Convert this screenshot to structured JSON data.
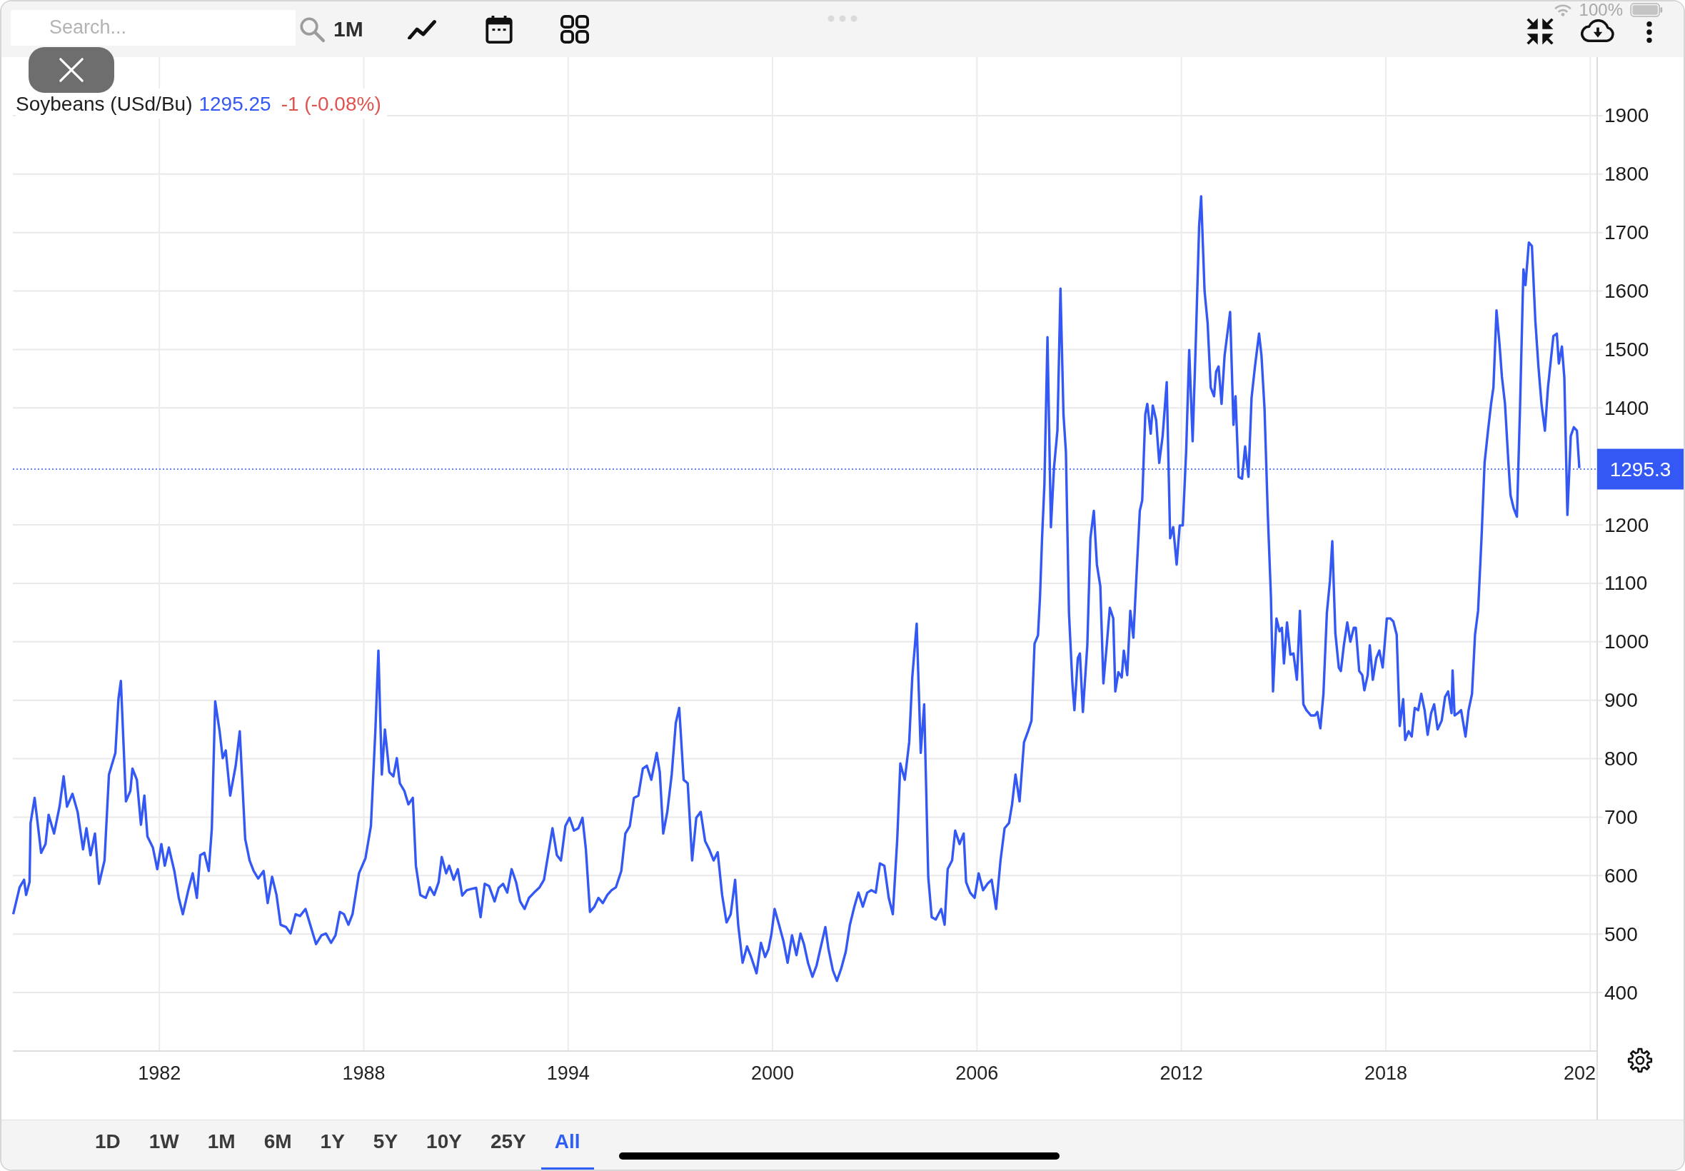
{
  "toolbar": {
    "search": {
      "placeholder": "Search..."
    },
    "interval": "1M"
  },
  "status_bar": {
    "battery": "100%"
  },
  "legend": {
    "price": "1295.25",
    "change": "-1 (-0.08%)"
  },
  "chart": {
    "chart_data": {
      "type": "line",
      "x": [
        1977.71,
        1977.9,
        1978.03,
        1978.09,
        1978.19,
        1978.22,
        1978.34,
        1978.53,
        1978.66,
        1978.75,
        1978.91,
        1979.07,
        1979.19,
        1979.29,
        1979.45,
        1979.6,
        1979.76,
        1979.86,
        1979.98,
        1980.11,
        1980.23,
        1980.39,
        1980.52,
        1980.71,
        1980.8,
        1980.87,
        1981.02,
        1981.15,
        1981.21,
        1981.34,
        1981.46,
        1981.56,
        1981.65,
        1981.81,
        1981.94,
        1982.06,
        1982.16,
        1982.28,
        1982.44,
        1982.57,
        1982.69,
        1982.85,
        1982.98,
        1983.1,
        1983.2,
        1983.32,
        1983.45,
        1983.54,
        1983.64,
        1983.77,
        1983.86,
        1983.95,
        1984.08,
        1984.24,
        1984.36,
        1984.52,
        1984.65,
        1984.77,
        1984.9,
        1985.06,
        1985.18,
        1985.31,
        1985.44,
        1985.56,
        1985.72,
        1985.85,
        1986,
        1986.13,
        1986.29,
        1986.45,
        1986.6,
        1986.76,
        1986.89,
        1987.04,
        1987.17,
        1987.3,
        1987.42,
        1987.55,
        1987.67,
        1987.86,
        1988.05,
        1988.21,
        1988.34,
        1988.43,
        1988.53,
        1988.62,
        1988.75,
        1988.87,
        1988.97,
        1989.06,
        1989.19,
        1989.31,
        1989.44,
        1989.53,
        1989.66,
        1989.82,
        1989.94,
        1990.07,
        1990.2,
        1990.29,
        1990.42,
        1990.51,
        1990.64,
        1990.76,
        1990.89,
        1991.02,
        1991.14,
        1991.3,
        1991.43,
        1991.55,
        1991.68,
        1991.84,
        1991.96,
        1992.09,
        1992.21,
        1992.34,
        1992.47,
        1992.59,
        1992.72,
        1992.85,
        1993,
        1993.16,
        1993.29,
        1993.41,
        1993.54,
        1993.67,
        1993.79,
        1993.92,
        1994.04,
        1994.17,
        1994.3,
        1994.42,
        1994.52,
        1994.64,
        1994.77,
        1994.89,
        1995.02,
        1995.15,
        1995.27,
        1995.4,
        1995.56,
        1995.68,
        1995.81,
        1995.93,
        1996.06,
        1996.19,
        1996.31,
        1996.44,
        1996.6,
        1996.69,
        1996.79,
        1996.91,
        1997.04,
        1997.16,
        1997.26,
        1997.39,
        1997.51,
        1997.64,
        1997.76,
        1997.89,
        1998.02,
        1998.14,
        1998.27,
        1998.39,
        1998.52,
        1998.65,
        1998.77,
        1998.9,
        1998.99,
        1999.12,
        1999.25,
        1999.37,
        1999.53,
        1999.66,
        1999.78,
        1999.88,
        1999.97,
        2000.06,
        2000.19,
        2000.32,
        2000.44,
        2000.57,
        2000.7,
        2000.82,
        2000.92,
        2001.04,
        2001.17,
        2001.29,
        2001.42,
        2001.55,
        2001.64,
        2001.77,
        2001.89,
        2002.02,
        2002.15,
        2002.27,
        2002.4,
        2002.52,
        2002.65,
        2002.78,
        2002.9,
        2003.03,
        2003.15,
        2003.28,
        2003.41,
        2003.53,
        2003.66,
        2003.75,
        2003.88,
        2004.01,
        2004.1,
        2004.23,
        2004.35,
        2004.45,
        2004.57,
        2004.67,
        2004.79,
        2004.95,
        2005.05,
        2005.14,
        2005.27,
        2005.36,
        2005.49,
        2005.61,
        2005.68,
        2005.8,
        2005.93,
        2006.05,
        2006.18,
        2006.31,
        2006.43,
        2006.56,
        2006.69,
        2006.81,
        2006.94,
        2007.03,
        2007.13,
        2007.25,
        2007.38,
        2007.5,
        2007.6,
        2007.69,
        2007.79,
        2007.85,
        2007.91,
        2007.98,
        2008.07,
        2008.17,
        2008.26,
        2008.36,
        2008.45,
        2008.54,
        2008.61,
        2008.7,
        2008.8,
        2008.86,
        2008.96,
        2009.02,
        2009.11,
        2009.24,
        2009.33,
        2009.43,
        2009.52,
        2009.62,
        2009.71,
        2009.81,
        2009.9,
        2010,
        2010.06,
        2010.15,
        2010.25,
        2010.31,
        2010.41,
        2010.5,
        2010.59,
        2010.69,
        2010.78,
        2010.85,
        2010.94,
        2011,
        2011.1,
        2011.16,
        2011.26,
        2011.35,
        2011.45,
        2011.57,
        2011.67,
        2011.76,
        2011.86,
        2011.95,
        2012.04,
        2012.14,
        2012.23,
        2012.33,
        2012.42,
        2012.52,
        2012.58,
        2012.68,
        2012.77,
        2012.86,
        2012.96,
        2013.02,
        2013.09,
        2013.18,
        2013.27,
        2013.43,
        2013.53,
        2013.59,
        2013.68,
        2013.78,
        2013.87,
        2013.97,
        2014.06,
        2014.16,
        2014.28,
        2014.35,
        2014.44,
        2014.54,
        2014.63,
        2014.69,
        2014.79,
        2014.88,
        2014.95,
        2015.01,
        2015.1,
        2015.2,
        2015.29,
        2015.39,
        2015.48,
        2015.58,
        2015.67,
        2015.8,
        2015.92,
        2015.99,
        2016.08,
        2016.17,
        2016.27,
        2016.36,
        2016.43,
        2016.52,
        2016.62,
        2016.68,
        2016.77,
        2016.87,
        2016.96,
        2017.06,
        2017.12,
        2017.22,
        2017.31,
        2017.37,
        2017.47,
        2017.53,
        2017.62,
        2017.72,
        2017.81,
        2017.91,
        2018.03,
        2018.13,
        2018.22,
        2018.32,
        2018.41,
        2018.51,
        2018.57,
        2018.67,
        2018.76,
        2018.85,
        2018.95,
        2019.04,
        2019.14,
        2019.23,
        2019.33,
        2019.42,
        2019.52,
        2019.64,
        2019.74,
        2019.83,
        2019.93,
        2019.96,
        2020.02,
        2020.12,
        2020.21,
        2020.34,
        2020.43,
        2020.53,
        2020.62,
        2020.71,
        2020.81,
        2020.9,
        2021,
        2021.09,
        2021.16,
        2021.25,
        2021.34,
        2021.41,
        2021.5,
        2021.6,
        2021.66,
        2021.75,
        2021.85,
        2021.94,
        2022.04,
        2022.1,
        2022.2,
        2022.29,
        2022.39,
        2022.48,
        2022.57,
        2022.67,
        2022.76,
        2022.86,
        2022.92,
        2023.02,
        2023.08,
        2023.17,
        2023.24,
        2023.33,
        2023.43,
        2023.52,
        2023.61,
        2023.68
      ],
      "series": [
        {
          "name": "Soybeans (USd/Bu)",
          "color": "#3358f4",
          "values": [
            534,
            580,
            593,
            567,
            589,
            690,
            733,
            639,
            654,
            704,
            672,
            718,
            770,
            718,
            740,
            709,
            645,
            681,
            635,
            672,
            586,
            626,
            773,
            810,
            902,
            933,
            727,
            745,
            783,
            764,
            687,
            737,
            667,
            648,
            611,
            654,
            617,
            648,
            608,
            562,
            534,
            575,
            604,
            562,
            635,
            639,
            608,
            681,
            898,
            847,
            801,
            814,
            737,
            788,
            847,
            663,
            626,
            608,
            595,
            608,
            553,
            598,
            567,
            516,
            512,
            501,
            534,
            531,
            543,
            512,
            483,
            498,
            501,
            485,
            498,
            538,
            534,
            516,
            534,
            604,
            630,
            685,
            847,
            985,
            773,
            850,
            777,
            770,
            801,
            758,
            745,
            722,
            733,
            617,
            567,
            562,
            580,
            567,
            589,
            632,
            604,
            617,
            593,
            611,
            566,
            575,
            577,
            579,
            529,
            586,
            582,
            556,
            579,
            586,
            571,
            611,
            589,
            556,
            543,
            562,
            571,
            580,
            593,
            635,
            681,
            635,
            626,
            685,
            699,
            677,
            681,
            699,
            645,
            538,
            547,
            562,
            553,
            567,
            575,
            580,
            608,
            672,
            685,
            733,
            737,
            783,
            788,
            764,
            810,
            777,
            672,
            709,
            773,
            861,
            887,
            764,
            758,
            626,
            699,
            709,
            659,
            645,
            626,
            640,
            567,
            520,
            534,
            593,
            516,
            451,
            479,
            461,
            433,
            485,
            461,
            474,
            501,
            543,
            516,
            488,
            451,
            498,
            464,
            501,
            483,
            451,
            427,
            446,
            479,
            512,
            475,
            438,
            420,
            442,
            470,
            516,
            547,
            571,
            547,
            571,
            575,
            571,
            621,
            617,
            562,
            534,
            663,
            792,
            764,
            828,
            939,
            1031,
            810,
            893,
            598,
            529,
            525,
            543,
            516,
            611,
            626,
            677,
            654,
            672,
            589,
            571,
            562,
            604,
            575,
            586,
            593,
            543,
            626,
            681,
            690,
            722,
            773,
            727,
            828,
            847,
            865,
            997,
            1011,
            1076,
            1177,
            1269,
            1521,
            1196,
            1297,
            1361,
            1604,
            1389,
            1325,
            1049,
            929,
            883,
            972,
            980,
            880,
            994,
            1177,
            1224,
            1132,
            1095,
            929,
            994,
            1058,
            1040,
            915,
            948,
            939,
            985,
            943,
            1053,
            1007,
            1122,
            1224,
            1242,
            1389,
            1407,
            1356,
            1404,
            1379,
            1306,
            1352,
            1444,
            1177,
            1196,
            1132,
            1199,
            1199,
            1325,
            1499,
            1343,
            1508,
            1711,
            1762,
            1600,
            1545,
            1435,
            1420,
            1462,
            1471,
            1407,
            1490,
            1564,
            1371,
            1420,
            1282,
            1279,
            1334,
            1282,
            1417,
            1471,
            1527,
            1490,
            1398,
            1214,
            1076,
            915,
            1040,
            1018,
            1024,
            963,
            1033,
            978,
            980,
            935,
            1053,
            893,
            883,
            874,
            874,
            880,
            852,
            911,
            1049,
            1104,
            1172,
            1015,
            956,
            950,
            994,
            1033,
            1000,
            1024,
            1024,
            950,
            943,
            917,
            943,
            994,
            935,
            972,
            985,
            956,
            1040,
            1040,
            1035,
            1012,
            856,
            902,
            832,
            847,
            838,
            887,
            883,
            911,
            883,
            841,
            878,
            893,
            850,
            865,
            906,
            915,
            878,
            951,
            874,
            878,
            883,
            838,
            883,
            911,
            1012,
            1053,
            1177,
            1306,
            1361,
            1407,
            1435,
            1567,
            1508,
            1453,
            1407,
            1306,
            1251,
            1229,
            1214,
            1398,
            1637,
            1610,
            1683,
            1677,
            1549,
            1471,
            1407,
            1361,
            1435,
            1490,
            1523,
            1527,
            1476,
            1505,
            1452,
            1217,
            1352,
            1367,
            1361,
            1297
          ]
        }
      ],
      "xlim": [
        1977.7,
        2024.1
      ],
      "ylim": [
        300,
        2000
      ],
      "xticks": [
        1982,
        1988,
        1994,
        2000,
        2006,
        2012,
        2018
      ],
      "yticks": [
        400,
        500,
        600,
        700,
        800,
        900,
        1000,
        1100,
        1200,
        1400,
        1500,
        1600,
        1700,
        1800,
        1900
      ],
      "grid": true,
      "ref_lines": [
        {
          "axis": "y",
          "value": 1295.3,
          "label": "1295.3"
        }
      ]
    },
    "cut_tick_label": "202"
  },
  "ranges": [
    {
      "label": "1D",
      "selected": false
    },
    {
      "label": "1W",
      "selected": false
    },
    {
      "label": "1M",
      "selected": false
    },
    {
      "label": "6M",
      "selected": false
    },
    {
      "label": "1Y",
      "selected": false
    },
    {
      "label": "5Y",
      "selected": false
    },
    {
      "label": "10Y",
      "selected": false
    },
    {
      "label": "25Y",
      "selected": false
    },
    {
      "label": "All",
      "selected": true
    }
  ]
}
